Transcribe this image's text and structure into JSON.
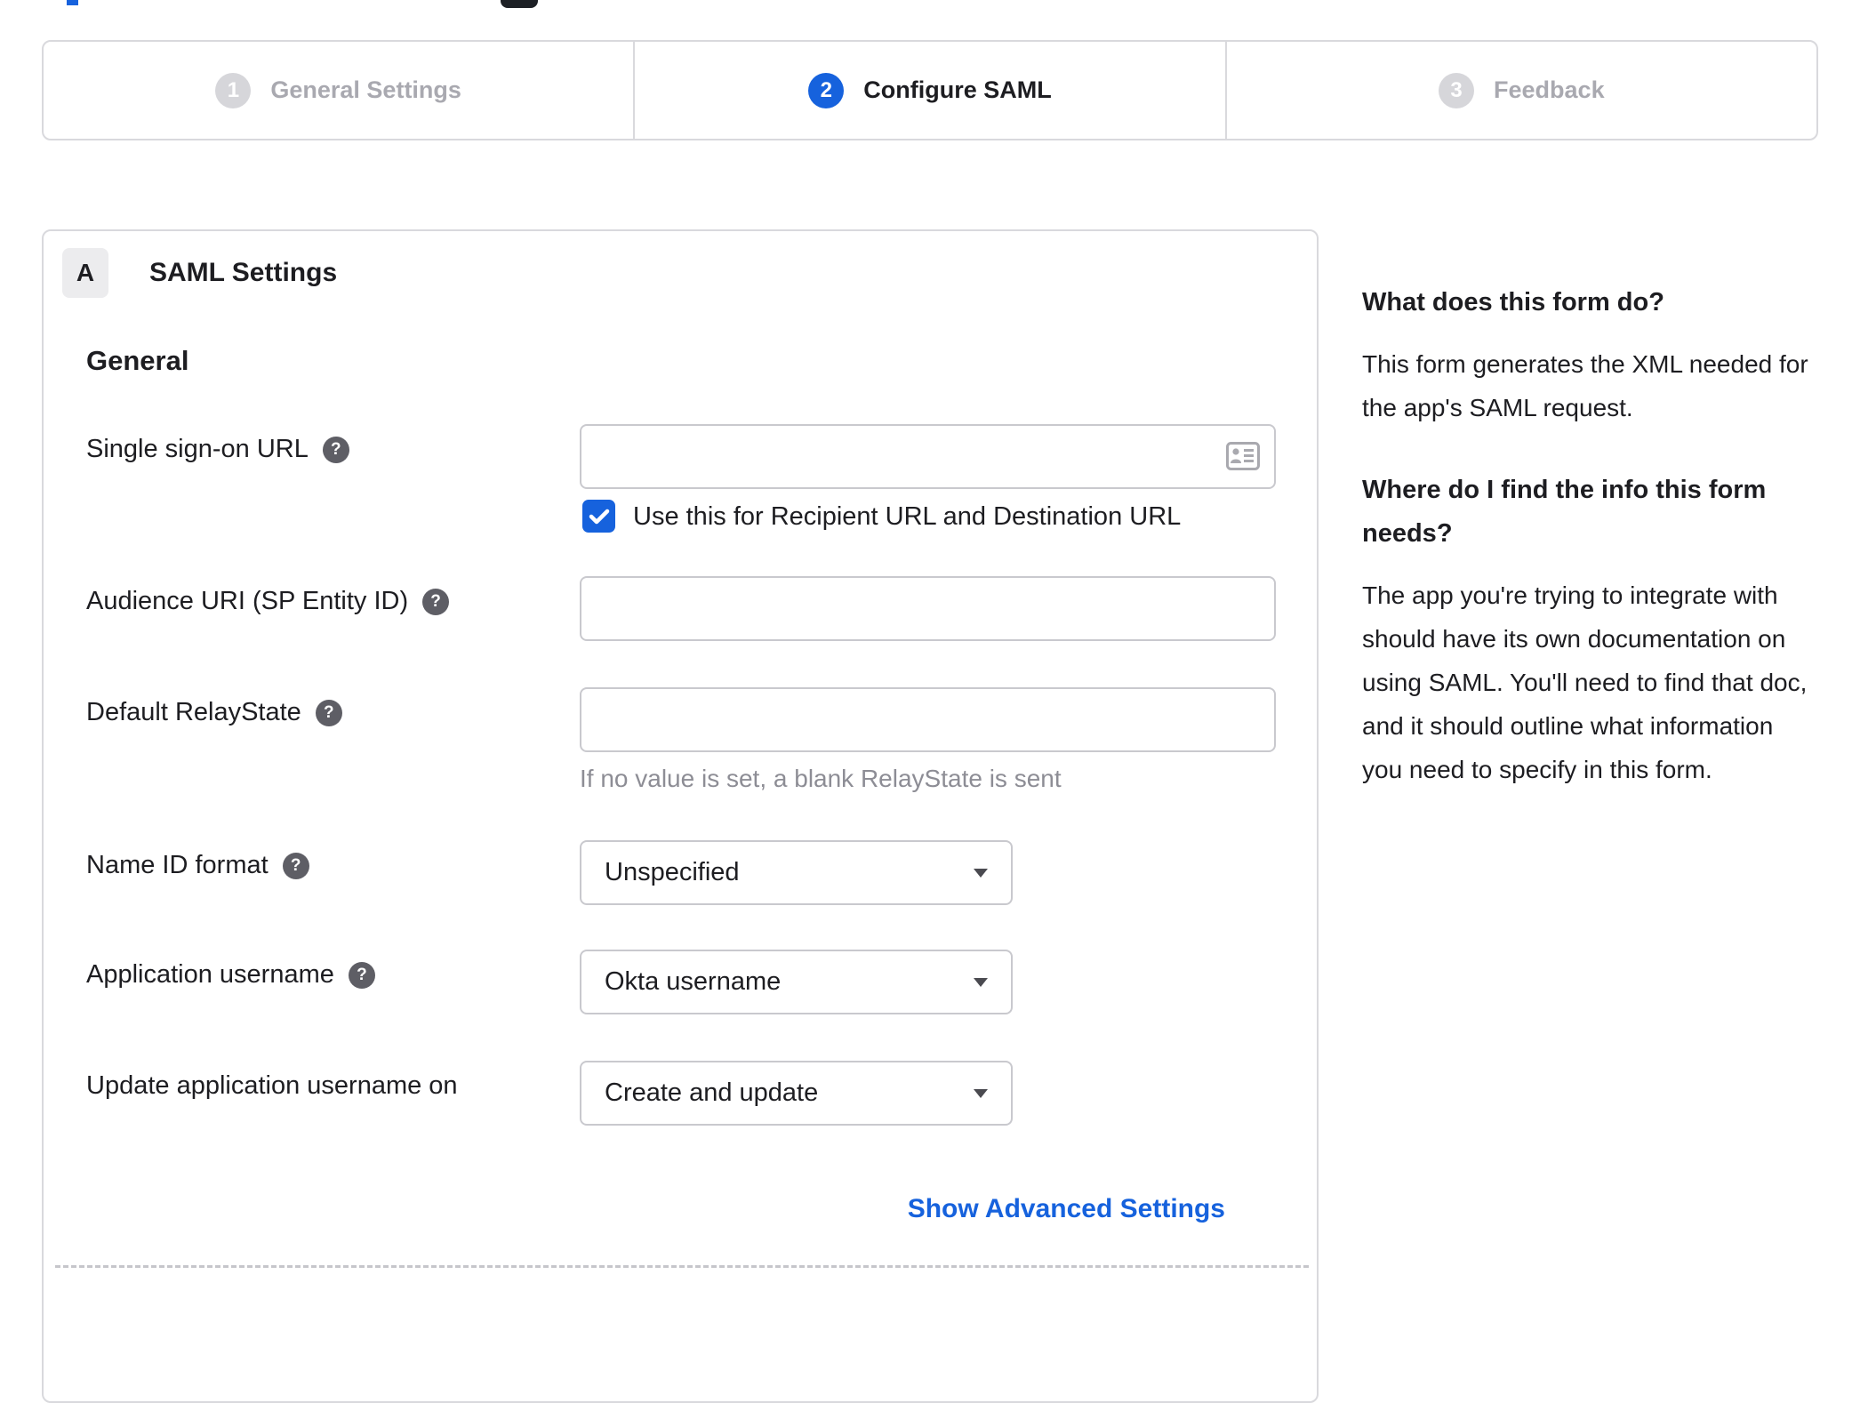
{
  "stepper": {
    "steps": [
      {
        "number": "1",
        "label": "General Settings",
        "state": "inactive"
      },
      {
        "number": "2",
        "label": "Configure SAML",
        "state": "active"
      },
      {
        "number": "3",
        "label": "Feedback",
        "state": "inactive"
      }
    ]
  },
  "panel": {
    "section_badge": "A",
    "section_title": "SAML Settings",
    "group_heading": "General",
    "fields": {
      "sso": {
        "label": "Single sign-on URL",
        "value": "",
        "checkbox_label": "Use this for Recipient URL and Destination URL",
        "checked": true
      },
      "audience": {
        "label": "Audience URI (SP Entity ID)",
        "value": ""
      },
      "relay": {
        "label": "Default RelayState",
        "value": "",
        "hint": "If no value is set, a blank RelayState is sent"
      },
      "name_id": {
        "label": "Name ID format",
        "value": "Unspecified"
      },
      "app_username": {
        "label": "Application username",
        "value": "Okta username"
      },
      "update_on": {
        "label": "Update application username on",
        "value": "Create and update"
      }
    },
    "advanced_link": "Show Advanced Settings"
  },
  "sidebar": {
    "heading1": "What does this form do?",
    "para1": "This form generates the XML needed for the app's SAML request.",
    "heading2": "Where do I find the info this form needs?",
    "para2": "The app you're trying to integrate with should have its own documentation on using SAML. You'll need to find that doc, and it should outline what information you need to specify in this form."
  },
  "icons": {
    "help": "question-mark",
    "sso_input": "contact-card",
    "checkbox": "checkmark"
  },
  "colors": {
    "accent_blue": "#1662dd",
    "inactive_gray": "#d6d6da",
    "border_gray": "#d9d9dd",
    "text_dark": "#1d1d21",
    "hint_gray": "#8d8d95"
  }
}
